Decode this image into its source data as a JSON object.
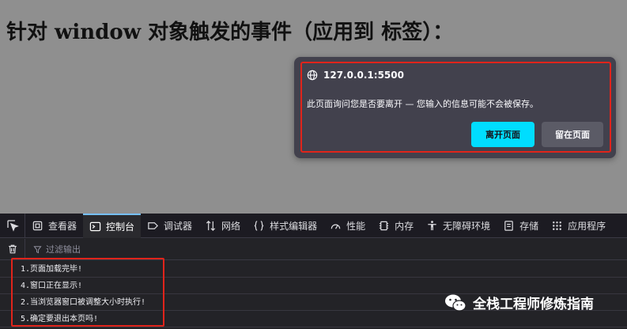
{
  "page": {
    "title": "针对 window 对象触发的事件（应用到 标签）："
  },
  "dialog": {
    "origin": "127.0.0.1:5500",
    "message": "此页面询问您是否要离开 — 您输入的信息可能不会被保存。",
    "leave_label": "离开页面",
    "stay_label": "留在页面"
  },
  "devtools": {
    "tabs": [
      {
        "label": "查看器",
        "icon": "inspector-icon"
      },
      {
        "label": "控制台",
        "icon": "console-icon",
        "selected": true
      },
      {
        "label": "调试器",
        "icon": "debugger-icon"
      },
      {
        "label": "网络",
        "icon": "network-icon"
      },
      {
        "label": "样式编辑器",
        "icon": "style-editor-icon"
      },
      {
        "label": "性能",
        "icon": "performance-icon"
      },
      {
        "label": "内存",
        "icon": "memory-icon"
      },
      {
        "label": "无障碍环境",
        "icon": "accessibility-icon"
      },
      {
        "label": "存储",
        "icon": "storage-icon"
      },
      {
        "label": "应用程序",
        "icon": "application-icon"
      }
    ],
    "filter_placeholder": "过滤输出",
    "console_lines": [
      "1.页面加载完毕!",
      "4.窗口正在显示!",
      "2.当浏览器窗口被调整大小时执行!",
      "5.确定要退出本页吗!"
    ]
  },
  "watermark": {
    "text": "全栈工程师修炼指南"
  },
  "colors": {
    "accent_button": "#00ddff",
    "highlight_border": "#e0241b",
    "selected_tab": "#75bfff"
  }
}
